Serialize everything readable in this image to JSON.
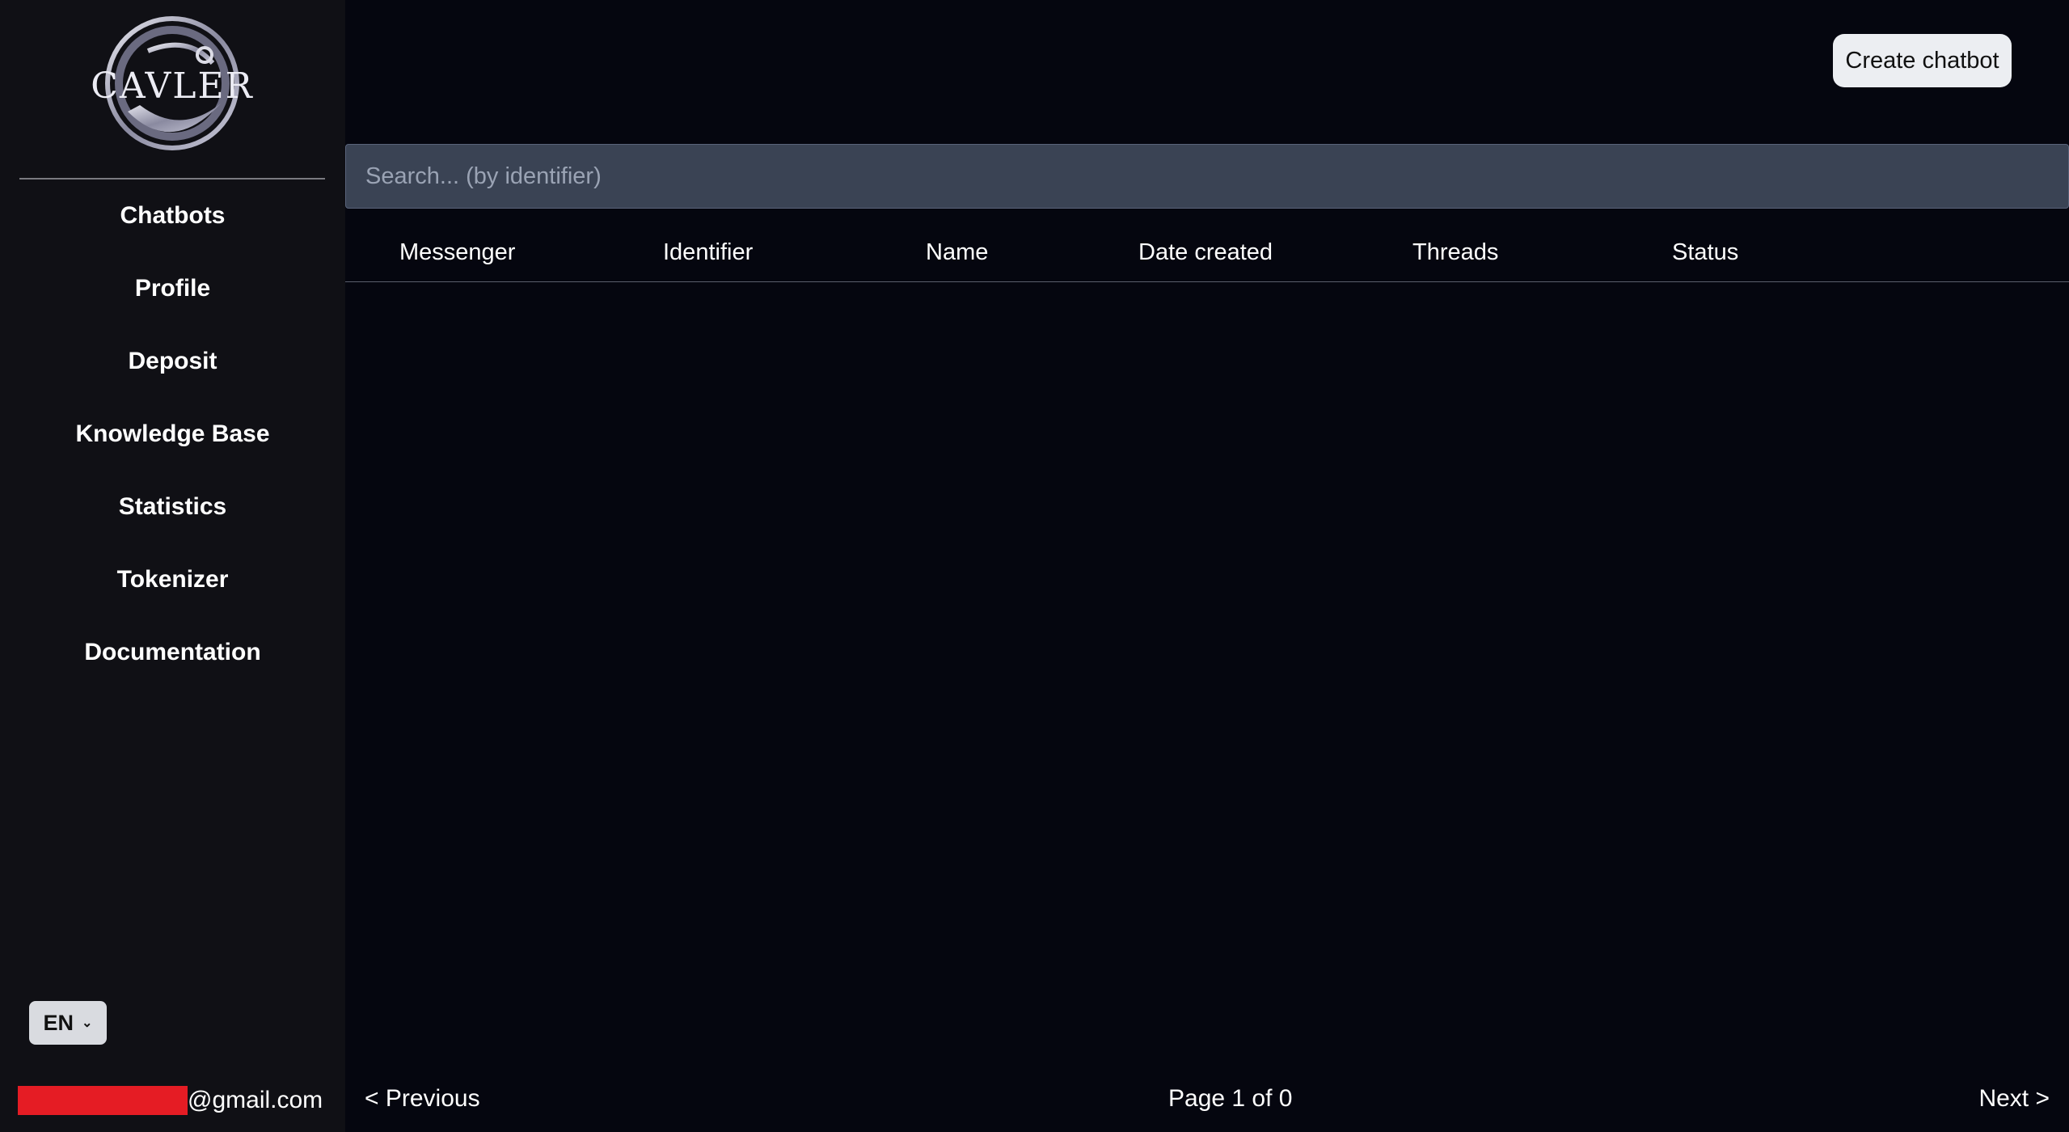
{
  "brand": {
    "logo_text": "CAVLER"
  },
  "sidebar": {
    "items": [
      {
        "label": "Chatbots"
      },
      {
        "label": "Profile"
      },
      {
        "label": "Deposit"
      },
      {
        "label": "Knowledge Base"
      },
      {
        "label": "Statistics"
      },
      {
        "label": "Tokenizer"
      },
      {
        "label": "Documentation"
      }
    ],
    "language": "EN",
    "user_email_domain": "@gmail.com"
  },
  "toolbar": {
    "create_label": "Create chatbot"
  },
  "search": {
    "placeholder": "Search... (by identifier)"
  },
  "table": {
    "columns": [
      "Messenger",
      "Identifier",
      "Name",
      "Date created",
      "Threads",
      "Status"
    ],
    "rows": []
  },
  "pagination": {
    "prev_label": "< Previous",
    "page_info": "Page 1 of 0",
    "next_label": "Next >"
  },
  "colors": {
    "background": "#05060f",
    "sidebar": "#101015",
    "search_bg": "#3a4354",
    "redaction": "#e51c24"
  }
}
